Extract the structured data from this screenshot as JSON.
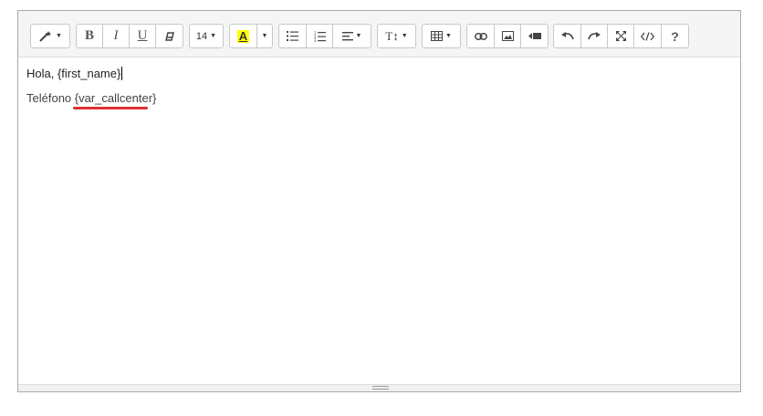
{
  "toolbar": {
    "font_size": "14",
    "help_label": "?",
    "bold_label": "B",
    "italic_label": "I",
    "underline_label": "U",
    "paragraph_label": "T↕",
    "highlight_letter": "A",
    "highlight_color": "#ffff00",
    "icons": [
      "magic-wand-icon",
      "bold-icon",
      "italic-icon",
      "underline-icon",
      "eraser-icon",
      "font-size-dropdown",
      "highlight-icon",
      "caret-icon",
      "unordered-list-icon",
      "ordered-list-icon",
      "align-icon",
      "line-height-icon",
      "table-icon",
      "link-icon",
      "picture-icon",
      "video-icon",
      "undo-icon",
      "redo-icon",
      "fullscreen-icon",
      "code-view-icon",
      "help-icon"
    ]
  },
  "content": {
    "line1": "Hola, {first_name}",
    "line2": "Teléfono {var_callcenter}"
  },
  "colors": {
    "annotation_red": "#e03030"
  }
}
